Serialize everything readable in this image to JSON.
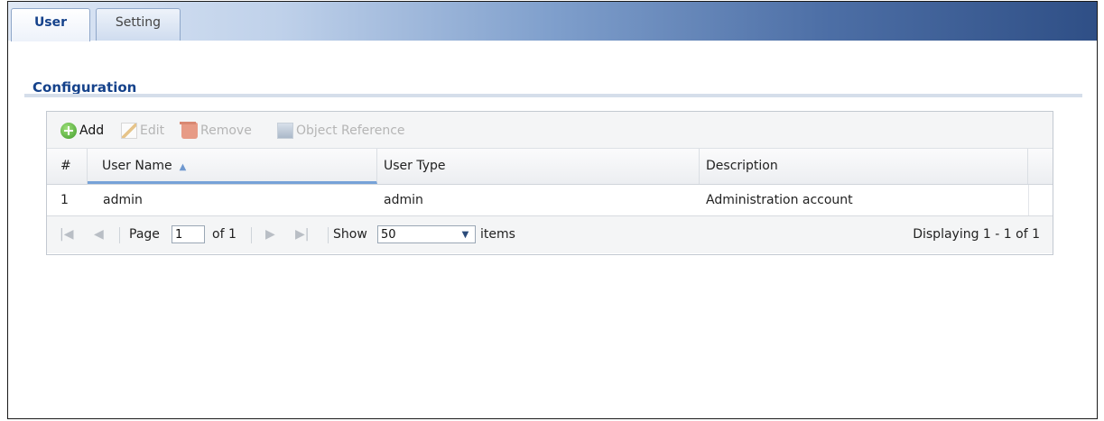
{
  "tabs": [
    {
      "label": "User",
      "active": true
    },
    {
      "label": "Setting",
      "active": false
    }
  ],
  "section": {
    "title": "Configuration"
  },
  "toolbar": {
    "add_label": "Add",
    "edit_label": "Edit",
    "remove_label": "Remove",
    "object_reference_label": "Object Reference",
    "icons": [
      "add-icon",
      "edit-icon",
      "remove-icon",
      "object-reference-icon"
    ]
  },
  "table": {
    "columns": [
      "#",
      "User Name",
      "User Type",
      "Description"
    ],
    "sorted_column": "User Name",
    "sort_direction": "ascending",
    "rows": [
      {
        "num": "1",
        "user_name": "admin",
        "user_type": "admin",
        "description": "Administration account"
      }
    ]
  },
  "pager": {
    "page_label": "Page",
    "page_value": "1",
    "of_label": "of 1",
    "show_label": "Show",
    "show_value": "50",
    "items_label": "items",
    "displaying": "Displaying 1 - 1 of 1"
  },
  "colors": {
    "accent": "#15428b",
    "sort_indicator": "#76a2d8",
    "add_icon": "#3f9b2a"
  }
}
